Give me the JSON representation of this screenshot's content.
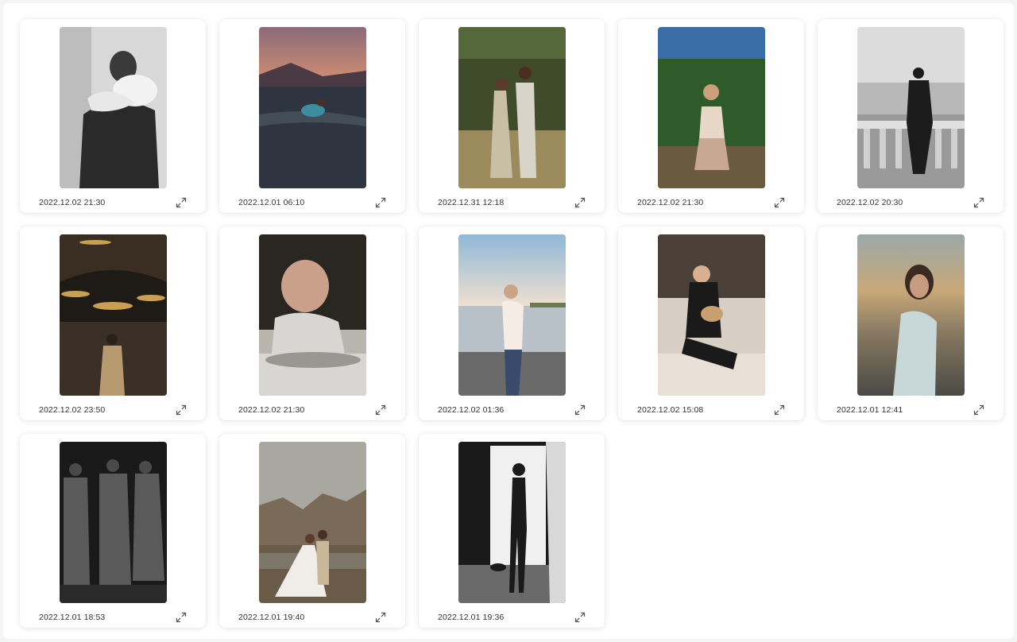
{
  "gallery": {
    "items": [
      {
        "timestamp": "2022.12.02 21:30",
        "subject": "couple-embrace-bw",
        "palette": [
          "#d8d8d8",
          "#2a2a2a",
          "#f2f2f2"
        ]
      },
      {
        "timestamp": "2022.12.01 06:10",
        "subject": "woman-in-lake-sunset",
        "palette": [
          "#c98a72",
          "#2e3440",
          "#3d8da0"
        ]
      },
      {
        "timestamp": "2022.12.31 12:18",
        "subject": "couple-in-field",
        "palette": [
          "#3f4b2a",
          "#9a8a5c",
          "#c9bfa7"
        ]
      },
      {
        "timestamp": "2022.12.02 21:30",
        "subject": "woman-in-garden",
        "palette": [
          "#3a6ea8",
          "#2f5a2a",
          "#e8d7c6"
        ]
      },
      {
        "timestamp": "2022.12.02 20:30",
        "subject": "man-on-balcony-bw",
        "palette": [
          "#dcdcdc",
          "#9a9a9a",
          "#1c1c1c"
        ]
      },
      {
        "timestamp": "2022.12.02 23:50",
        "subject": "mosque-interior",
        "palette": [
          "#1e1a16",
          "#c8a050",
          "#3a3026"
        ]
      },
      {
        "timestamp": "2022.12.02 21:30",
        "subject": "smiling-baby",
        "palette": [
          "#2a2622",
          "#d8d6d2",
          "#caa08a"
        ]
      },
      {
        "timestamp": "2022.12.02 01:36",
        "subject": "woman-by-lake",
        "palette": [
          "#8fb8d8",
          "#f0e0d0",
          "#6a6a6a"
        ]
      },
      {
        "timestamp": "2022.12.02 15:08",
        "subject": "woman-with-cat-on-sofa",
        "palette": [
          "#2a2420",
          "#d8cfc4",
          "#1a1a1a"
        ]
      },
      {
        "timestamp": "2022.12.01 12:41",
        "subject": "woman-in-wind",
        "palette": [
          "#8a7a62",
          "#4a4a44",
          "#c8d8d8"
        ]
      },
      {
        "timestamp": "2022.12.01 18:53",
        "subject": "three-people-dark",
        "palette": [
          "#1a1a1a",
          "#5a5a5a",
          "#2a2a2a"
        ]
      },
      {
        "timestamp": "2022.12.01 19:40",
        "subject": "wedding-mountains",
        "palette": [
          "#a8a8a0",
          "#6a5a48",
          "#f0ede8"
        ]
      },
      {
        "timestamp": "2022.12.01 19:36",
        "subject": "silhouette-doorway-bw",
        "palette": [
          "#f0f0f0",
          "#1a1a1a",
          "#6a6a6a"
        ]
      }
    ]
  }
}
